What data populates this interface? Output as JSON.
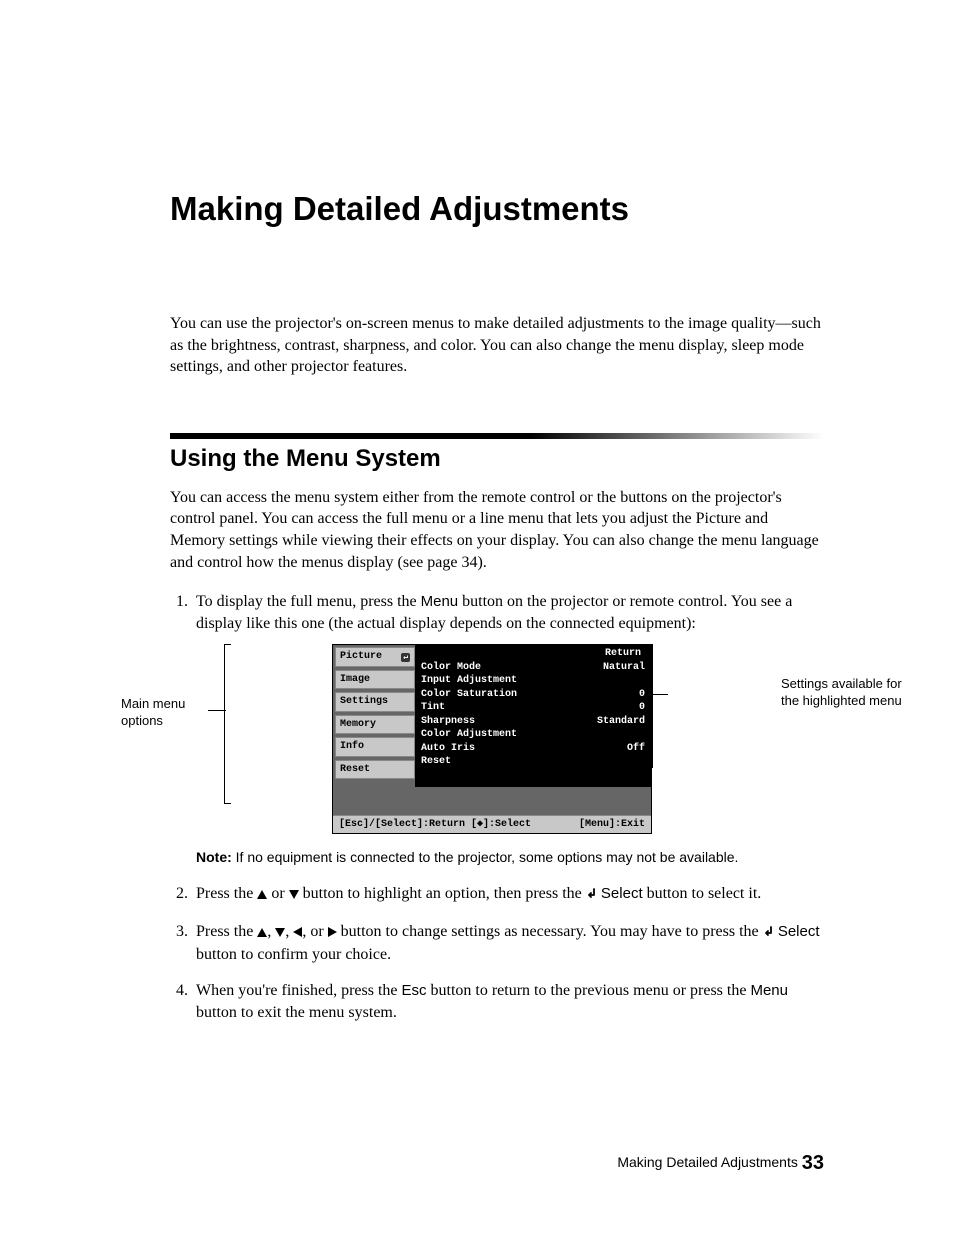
{
  "title": "Making Detailed Adjustments",
  "intro": "You can use the projector's on-screen menus to make detailed adjustments to the image quality—such as the brightness, contrast, sharpness, and color. You can also change the menu display, sleep mode settings, and other projector features.",
  "section": {
    "heading": "Using the Menu System",
    "body": "You can access the menu system either from the remote control or the buttons on the projector's control panel. You can access the full menu or a line menu that lets you adjust the Picture and Memory settings while viewing their effects on your display. You can also change the menu language and control how the menus display (see page 34)."
  },
  "steps": {
    "s1a": "To display the full menu, press the ",
    "s1_menu": "Menu",
    "s1b": " button on the projector or remote control. You see a display like this one (the actual display depends on the connected equipment):",
    "s2a": "Press the ",
    "s2_or": " or ",
    "s2b": " button to highlight an option, then press the ",
    "s2_select": " Select",
    "s2c": " button to select it.",
    "s3a": "Press the ",
    "s3_comma": ", ",
    "s3_or": ", or ",
    "s3b": " button to change settings as necessary. You may have to press the ",
    "s3_select": " Select",
    "s3c": " button to confirm your choice.",
    "s4a": "When you're finished, press the ",
    "s4_esc": "Esc",
    "s4b": " button to return to the previous menu or press the ",
    "s4_menu": "Menu",
    "s4c": " button to exit the menu system."
  },
  "note": {
    "label": "Note:",
    "text": " If no equipment is connected to the projector, some options may not be available."
  },
  "callouts": {
    "left": "Main menu options",
    "right": "Settings available for the highlighted menu"
  },
  "osd": {
    "tabs": [
      "Picture",
      "Image",
      "Settings",
      "Memory",
      "Info",
      "Reset"
    ],
    "return": "Return",
    "rows": [
      {
        "label": "Color Mode",
        "value": "Natural"
      },
      {
        "label": "Input Adjustment",
        "value": ""
      },
      {
        "label": "Color Saturation",
        "value": "0"
      },
      {
        "label": "Tint",
        "value": "0"
      },
      {
        "label": "Sharpness",
        "value": "Standard"
      },
      {
        "label": "Color Adjustment",
        "value": ""
      },
      {
        "label": "Auto Iris",
        "value": "Off"
      },
      {
        "label": "Reset",
        "value": ""
      }
    ],
    "footer_left": "[Esc]/[Select]:Return [◆]:Select",
    "footer_right": "[Menu]:Exit"
  },
  "footer": {
    "text": "Making Detailed Adjustments ",
    "page": "33"
  }
}
